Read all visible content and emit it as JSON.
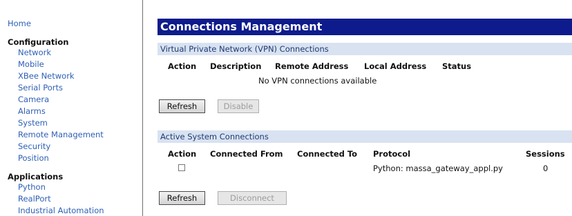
{
  "sidebar": {
    "home": "Home",
    "configuration": {
      "heading": "Configuration",
      "items": [
        "Network",
        "Mobile",
        "XBee Network",
        "Serial Ports",
        "Camera",
        "Alarms",
        "System",
        "Remote Management",
        "Security",
        "Position"
      ]
    },
    "applications": {
      "heading": "Applications",
      "items": [
        "Python",
        "RealPort",
        "Industrial Automation"
      ]
    }
  },
  "main": {
    "title": "Connections Management",
    "vpn": {
      "section_title": "Virtual Private Network (VPN) Connections",
      "columns": [
        "Action",
        "Description",
        "Remote Address",
        "Local Address",
        "Status"
      ],
      "empty_message": "No VPN connections available",
      "refresh_label": "Refresh",
      "disable_label": "Disable"
    },
    "active": {
      "section_title": "Active System Connections",
      "columns": [
        "Action",
        "Connected From",
        "Connected To",
        "Protocol",
        "Sessions"
      ],
      "rows": [
        {
          "checked": false,
          "connected_from": "",
          "connected_to": "",
          "protocol": "Python: massa_gateway_appl.py",
          "sessions": "0"
        }
      ],
      "refresh_label": "Refresh",
      "disconnect_label": "Disconnect"
    }
  },
  "colors": {
    "title_bar": "#0e1b8c",
    "section_bar": "#d8e2f1",
    "link": "#2d5fb5"
  }
}
